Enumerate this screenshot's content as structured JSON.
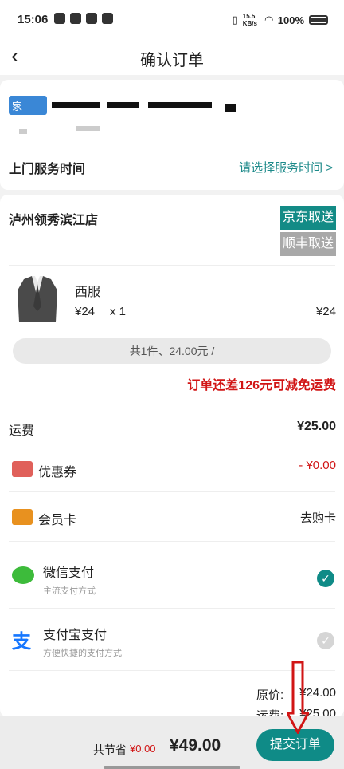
{
  "status": {
    "time": "15:06",
    "net": "15.5 KB/s",
    "battery": "100%"
  },
  "nav": {
    "title": "确认订单"
  },
  "address": {
    "tag": "家"
  },
  "service_time": {
    "label": "上门服务时间",
    "link": "请选择服务时间 >"
  },
  "store": {
    "name": "泸州领秀滨江店",
    "jd": "京东取送",
    "sf": "顺丰取送"
  },
  "item": {
    "name": "西服",
    "price": "¥24",
    "qty": "x 1",
    "total": "¥24"
  },
  "summary": "共1件、24.00元 /",
  "notice": "订单还差126元可减免运费",
  "shipping": {
    "label": "运费",
    "value": "¥25.00"
  },
  "coupon": {
    "label": "优惠券",
    "value": "- ¥0.00"
  },
  "member": {
    "label": "会员卡",
    "value": "去购卡"
  },
  "wechat": {
    "label": "微信支付",
    "sub": "主流支付方式"
  },
  "alipay": {
    "label": "支付宝支付",
    "sub": "方便快捷的支付方式"
  },
  "totals": {
    "orig_label": "原价:",
    "orig_value": "¥24.00",
    "ship_label": "运费:",
    "ship_value": "¥25.00"
  },
  "bottom": {
    "save_label": "共节省",
    "save_value": "¥0.00",
    "grand": "¥49.00",
    "submit": "提交订单"
  },
  "colors": {
    "accent": "#0f8b87",
    "warn": "#d11515"
  }
}
